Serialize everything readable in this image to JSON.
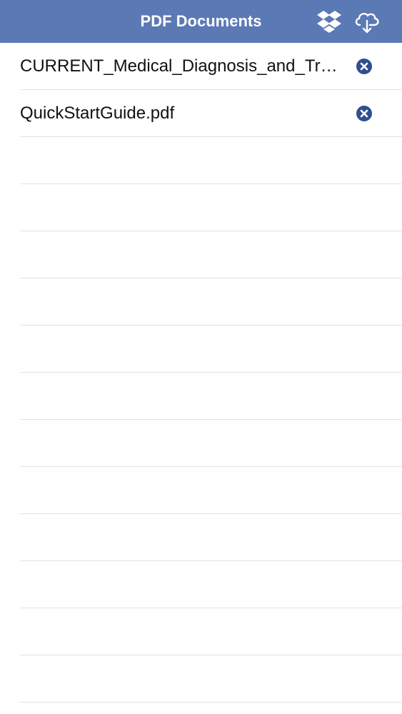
{
  "header": {
    "title": "PDF Documents",
    "background_color": "#5b79b4",
    "actions": [
      {
        "icon": "dropbox-icon"
      },
      {
        "icon": "cloud-download-icon"
      }
    ]
  },
  "documents": [
    {
      "name": "CURRENT_Medical_Diagnosis_and_Treatment.pdf",
      "delete_icon": "close-circle-icon"
    },
    {
      "name": "QuickStartGuide.pdf",
      "delete_icon": "close-circle-icon"
    }
  ],
  "accent_color": "#2f4f8f"
}
